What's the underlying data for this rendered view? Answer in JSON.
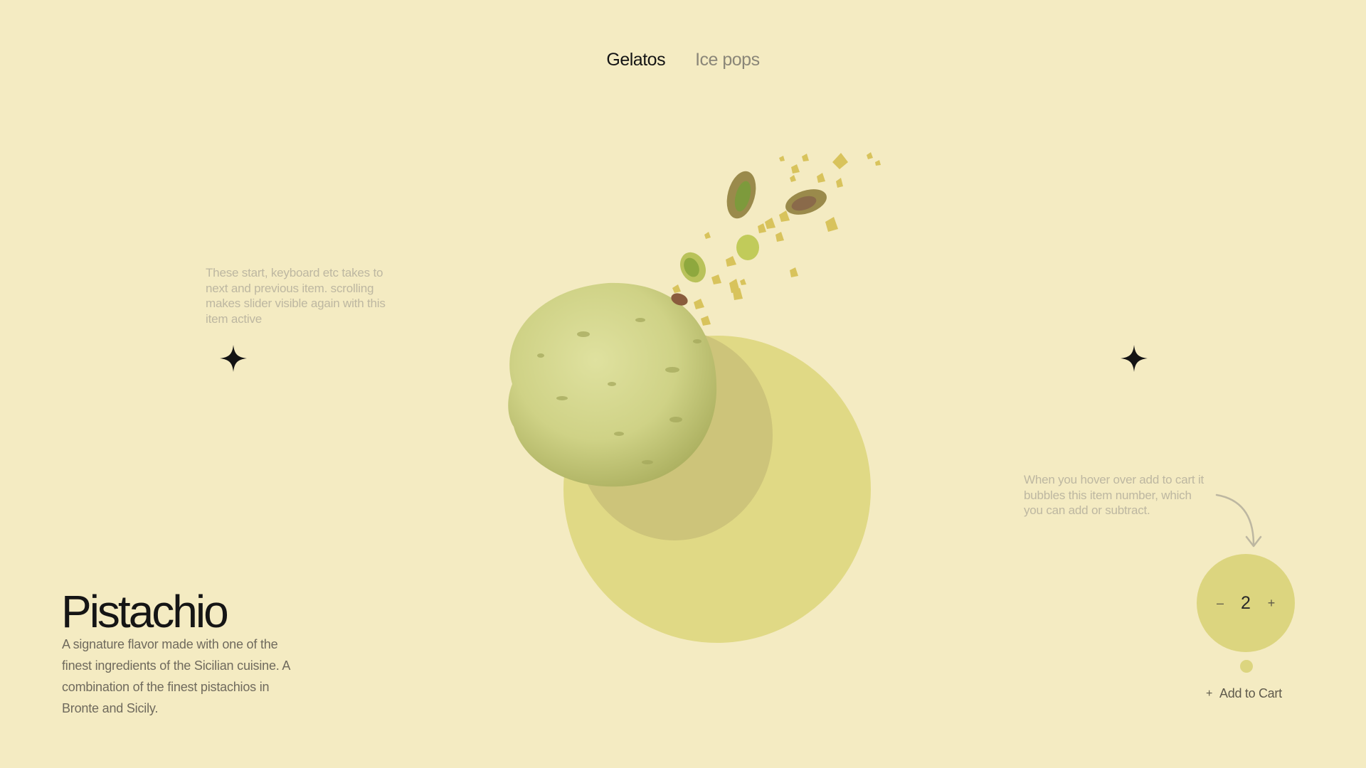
{
  "tabs": [
    {
      "label": "Gelatos",
      "active": true
    },
    {
      "label": "Ice pops",
      "active": false
    }
  ],
  "notes": {
    "left": "These start, keyboard etc takes to next and previous item. scrolling makes slider visible again with this item active",
    "right": "When you hover over add to cart it bubbles this item number, which you can add or subtract."
  },
  "product": {
    "name": "Pistachio",
    "description": "A signature flavor made with one of the finest ingredients of the Sicilian cuisine. A combination of the finest pistachios in Bronte and Sicily."
  },
  "cart": {
    "quantity": "2",
    "decrement_label": "–",
    "increment_label": "+",
    "add_label": "Add to Cart",
    "add_icon": "+"
  },
  "icons": {
    "sparkle": "four-point-star-icon",
    "arrow": "curved-arrow-icon"
  },
  "colors": {
    "background": "#f4ebc2",
    "accent": "#dcd57f",
    "scoop": "#c9cc7e"
  }
}
